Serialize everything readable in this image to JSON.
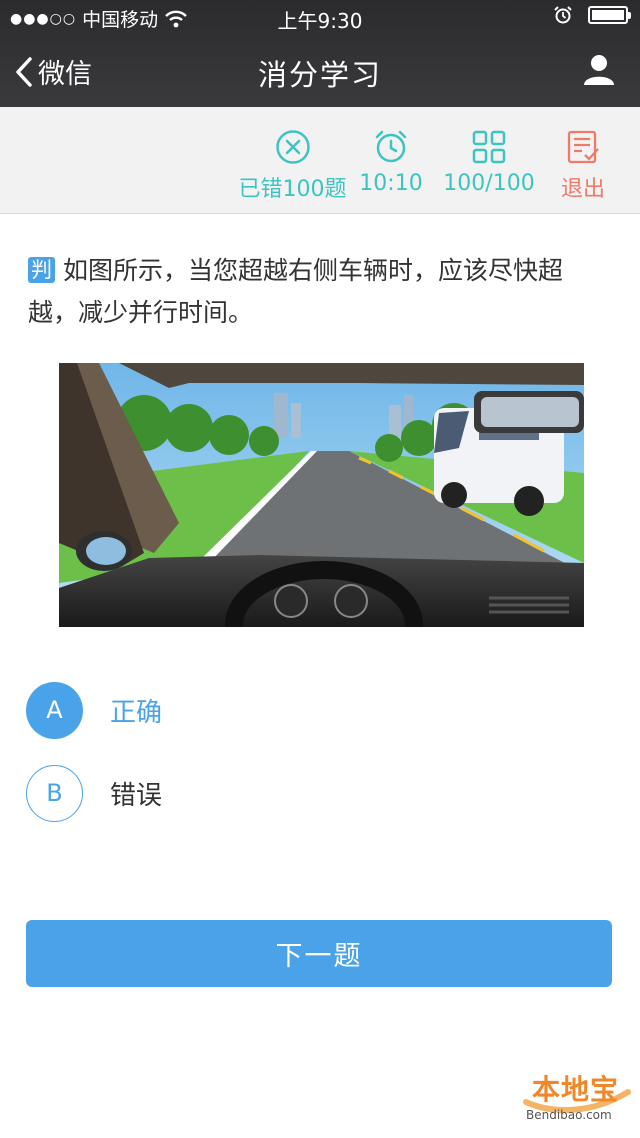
{
  "status_bar": {
    "carrier": "中国移动",
    "signal_dots": "●●●○○",
    "time": "上午9:30"
  },
  "nav": {
    "back_label": "微信",
    "title": "消分学习"
  },
  "toolbar": {
    "wrong": "已错100题",
    "timer": "10:10",
    "progress": "100/100",
    "exit": "退出",
    "colors": {
      "teal": "#3ec4c0",
      "red": "#f07a6a"
    }
  },
  "question": {
    "type_badge": "判",
    "text": "如图所示，当您超越右侧车辆时，应该尽快超越，减少并行时间。"
  },
  "options": [
    {
      "letter": "A",
      "text": "正确",
      "selected": true
    },
    {
      "letter": "B",
      "text": "错误",
      "selected": false
    }
  ],
  "next_button": "下一题",
  "watermark": {
    "text": "本地宝",
    "url": "Bendibao.com"
  },
  "accent_color": "#4aa3e8",
  "icons": [
    "chevron-left-icon",
    "user-icon",
    "wifi-icon",
    "alarm-icon",
    "close-circle-icon",
    "alarm-clock-icon",
    "grid-icon",
    "exit-list-icon"
  ]
}
